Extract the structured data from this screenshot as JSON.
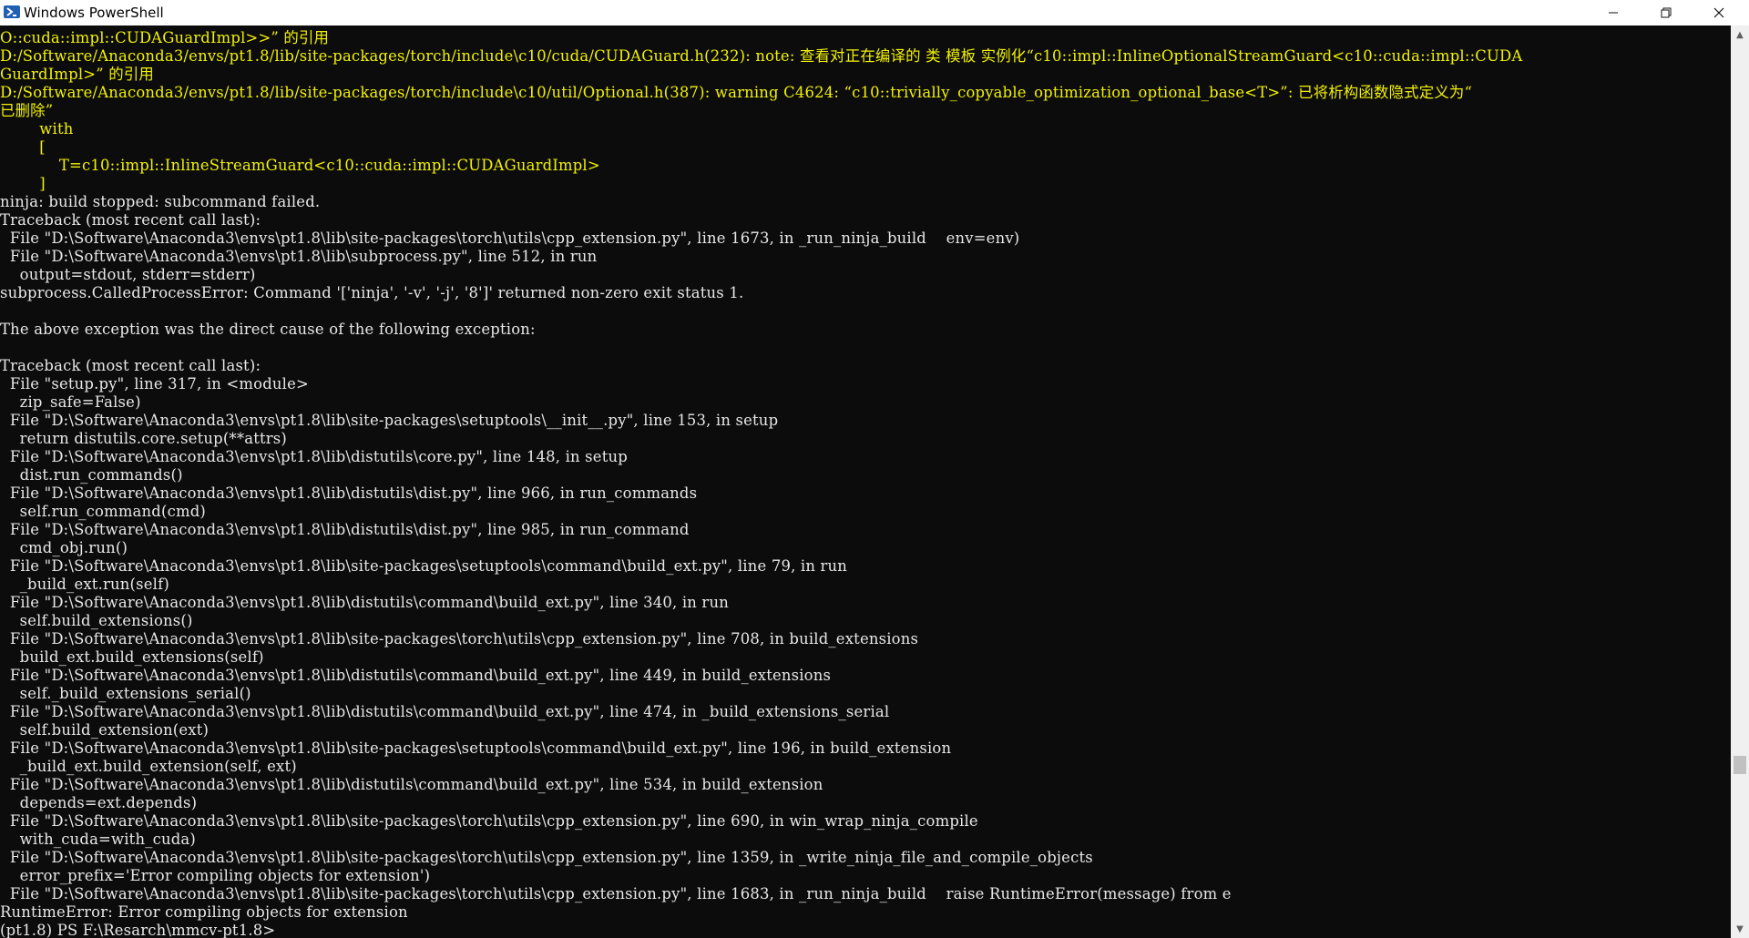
{
  "window": {
    "title": "Windows PowerShell",
    "icon": "powershell-icon",
    "controls": {
      "minimize": "minimize-icon",
      "maximize": "restore-icon",
      "close": "close-icon"
    }
  },
  "colors": {
    "background": "#0c0c0c",
    "warning_text": "#f2f200",
    "normal_text": "#e8e8e8",
    "titlebar": "#ffffff"
  },
  "console": {
    "lines": [
      {
        "text": "O::cuda::impl::CUDAGuardImpl>>” 的引用",
        "style": "warn"
      },
      {
        "text": "D:/Software/Anaconda3/envs/pt1.8/lib/site-packages/torch/include\\c10/cuda/CUDAGuard.h(232): note: 查看对正在编译的 类 模板 实例化“c10::impl::InlineOptionalStreamGuard<c10::cuda::impl::CUDA",
        "style": "warn"
      },
      {
        "text": "GuardImpl>” 的引用",
        "style": "warn"
      },
      {
        "text": "D:/Software/Anaconda3/envs/pt1.8/lib/site-packages/torch/include\\c10/util/Optional.h(387): warning C4624: “c10::trivially_copyable_optimization_optional_base<T>”: 已将析构函数隐式定义为“",
        "style": "warn"
      },
      {
        "text": "已删除”",
        "style": "warn"
      },
      {
        "text": "        with",
        "style": "warn"
      },
      {
        "text": "        [",
        "style": "warn"
      },
      {
        "text": "            T=c10::impl::InlineStreamGuard<c10::cuda::impl::CUDAGuardImpl>",
        "style": "warn"
      },
      {
        "text": "        ]",
        "style": "warn"
      },
      {
        "text": "ninja: build stopped: subcommand failed.",
        "style": "text"
      },
      {
        "text": "Traceback (most recent call last):",
        "style": "text"
      },
      {
        "text": "  File \"D:\\Software\\Anaconda3\\envs\\pt1.8\\lib\\site-packages\\torch\\utils\\cpp_extension.py\", line 1673, in _run_ninja_build    env=env)",
        "style": "text"
      },
      {
        "text": "  File \"D:\\Software\\Anaconda3\\envs\\pt1.8\\lib\\subprocess.py\", line 512, in run",
        "style": "text"
      },
      {
        "text": "    output=stdout, stderr=stderr)",
        "style": "text"
      },
      {
        "text": "subprocess.CalledProcessError: Command '['ninja', '-v', '-j', '8']' returned non-zero exit status 1.",
        "style": "text"
      },
      {
        "text": "",
        "style": "text"
      },
      {
        "text": "The above exception was the direct cause of the following exception:",
        "style": "text"
      },
      {
        "text": "",
        "style": "text"
      },
      {
        "text": "Traceback (most recent call last):",
        "style": "text"
      },
      {
        "text": "  File \"setup.py\", line 317, in <module>",
        "style": "text"
      },
      {
        "text": "    zip_safe=False)",
        "style": "text"
      },
      {
        "text": "  File \"D:\\Software\\Anaconda3\\envs\\pt1.8\\lib\\site-packages\\setuptools\\__init__.py\", line 153, in setup",
        "style": "text"
      },
      {
        "text": "    return distutils.core.setup(**attrs)",
        "style": "text"
      },
      {
        "text": "  File \"D:\\Software\\Anaconda3\\envs\\pt1.8\\lib\\distutils\\core.py\", line 148, in setup",
        "style": "text"
      },
      {
        "text": "    dist.run_commands()",
        "style": "text"
      },
      {
        "text": "  File \"D:\\Software\\Anaconda3\\envs\\pt1.8\\lib\\distutils\\dist.py\", line 966, in run_commands",
        "style": "text"
      },
      {
        "text": "    self.run_command(cmd)",
        "style": "text"
      },
      {
        "text": "  File \"D:\\Software\\Anaconda3\\envs\\pt1.8\\lib\\distutils\\dist.py\", line 985, in run_command",
        "style": "text"
      },
      {
        "text": "    cmd_obj.run()",
        "style": "text"
      },
      {
        "text": "  File \"D:\\Software\\Anaconda3\\envs\\pt1.8\\lib\\site-packages\\setuptools\\command\\build_ext.py\", line 79, in run",
        "style": "text"
      },
      {
        "text": "    _build_ext.run(self)",
        "style": "text"
      },
      {
        "text": "  File \"D:\\Software\\Anaconda3\\envs\\pt1.8\\lib\\distutils\\command\\build_ext.py\", line 340, in run",
        "style": "text"
      },
      {
        "text": "    self.build_extensions()",
        "style": "text"
      },
      {
        "text": "  File \"D:\\Software\\Anaconda3\\envs\\pt1.8\\lib\\site-packages\\torch\\utils\\cpp_extension.py\", line 708, in build_extensions",
        "style": "text"
      },
      {
        "text": "    build_ext.build_extensions(self)",
        "style": "text"
      },
      {
        "text": "  File \"D:\\Software\\Anaconda3\\envs\\pt1.8\\lib\\distutils\\command\\build_ext.py\", line 449, in build_extensions",
        "style": "text"
      },
      {
        "text": "    self._build_extensions_serial()",
        "style": "text"
      },
      {
        "text": "  File \"D:\\Software\\Anaconda3\\envs\\pt1.8\\lib\\distutils\\command\\build_ext.py\", line 474, in _build_extensions_serial",
        "style": "text"
      },
      {
        "text": "    self.build_extension(ext)",
        "style": "text"
      },
      {
        "text": "  File \"D:\\Software\\Anaconda3\\envs\\pt1.8\\lib\\site-packages\\setuptools\\command\\build_ext.py\", line 196, in build_extension",
        "style": "text"
      },
      {
        "text": "    _build_ext.build_extension(self, ext)",
        "style": "text"
      },
      {
        "text": "  File \"D:\\Software\\Anaconda3\\envs\\pt1.8\\lib\\distutils\\command\\build_ext.py\", line 534, in build_extension",
        "style": "text"
      },
      {
        "text": "    depends=ext.depends)",
        "style": "text"
      },
      {
        "text": "  File \"D:\\Software\\Anaconda3\\envs\\pt1.8\\lib\\site-packages\\torch\\utils\\cpp_extension.py\", line 690, in win_wrap_ninja_compile",
        "style": "text"
      },
      {
        "text": "    with_cuda=with_cuda)",
        "style": "text"
      },
      {
        "text": "  File \"D:\\Software\\Anaconda3\\envs\\pt1.8\\lib\\site-packages\\torch\\utils\\cpp_extension.py\", line 1359, in _write_ninja_file_and_compile_objects",
        "style": "text"
      },
      {
        "text": "    error_prefix='Error compiling objects for extension')",
        "style": "text"
      },
      {
        "text": "  File \"D:\\Software\\Anaconda3\\envs\\pt1.8\\lib\\site-packages\\torch\\utils\\cpp_extension.py\", line 1683, in _run_ninja_build    raise RuntimeError(message) from e",
        "style": "text"
      },
      {
        "text": "RuntimeError: Error compiling objects for extension",
        "style": "text"
      },
      {
        "text": "(pt1.8) PS F:\\Resarch\\mmcv-pt1.8>",
        "style": "text"
      }
    ]
  }
}
